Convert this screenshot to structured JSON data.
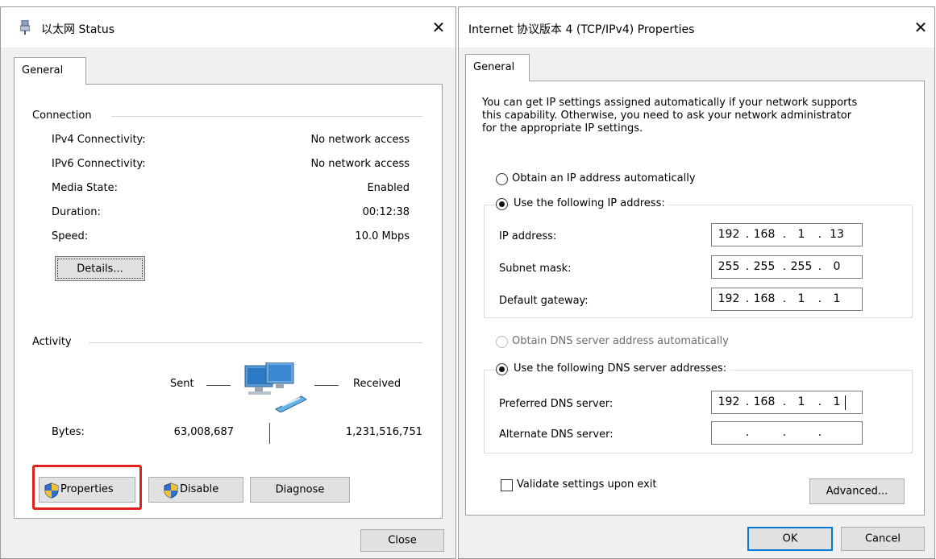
{
  "status_window": {
    "title": "以太网 Status",
    "tab": "General",
    "connection": {
      "heading": "Connection",
      "rows": [
        {
          "label": "IPv4 Connectivity:",
          "value": "No network access"
        },
        {
          "label": "IPv6 Connectivity:",
          "value": "No network access"
        },
        {
          "label": "Media State:",
          "value": "Enabled"
        },
        {
          "label": "Duration:",
          "value": "00:12:38"
        },
        {
          "label": "Speed:",
          "value": "10.0 Mbps"
        }
      ],
      "details_button": "Details..."
    },
    "activity": {
      "heading": "Activity",
      "sent_label": "Sent",
      "received_label": "Received",
      "bytes_label": "Bytes:",
      "bytes_sent": "63,008,687",
      "bytes_received": "1,231,516,751"
    },
    "buttons": {
      "properties": "Properties",
      "disable": "Disable",
      "diagnose": "Diagnose",
      "close": "Close"
    },
    "highlight_color": "#e0211e"
  },
  "ipv4_window": {
    "title": "Internet 协议版本 4 (TCP/IPv4) Properties",
    "tab": "General",
    "intro": [
      "You can get IP settings assigned automatically if your network supports",
      "this capability. Otherwise, you need to ask your network administrator",
      "for the appropriate IP settings."
    ],
    "ip_options": {
      "auto": "Obtain an IP address automatically",
      "manual": "Use the following IP address:",
      "selected": "manual"
    },
    "ip_fields": [
      {
        "label": "IP address:",
        "octets": [
          "192",
          "168",
          "1",
          "13"
        ]
      },
      {
        "label": "Subnet mask:",
        "octets": [
          "255",
          "255",
          "255",
          "0"
        ]
      },
      {
        "label": "Default gateway:",
        "octets": [
          "192",
          "168",
          "1",
          "1"
        ]
      }
    ],
    "dns_options": {
      "auto": "Obtain DNS server address automatically",
      "manual": "Use the following DNS server addresses:",
      "selected": "manual",
      "auto_disabled": true
    },
    "dns_fields": [
      {
        "label": "Preferred DNS server:",
        "octets": [
          "192",
          "168",
          "1",
          "1"
        ]
      },
      {
        "label": "Alternate DNS server:",
        "octets": [
          "",
          "",
          "",
          ""
        ]
      }
    ],
    "validate_label": "Validate settings upon exit",
    "validate_checked": false,
    "advanced_button": "Advanced...",
    "ok_button": "OK",
    "cancel_button": "Cancel"
  },
  "icons": {
    "window_icon": "network-adapter-icon",
    "close": "close-icon",
    "network": "network-computers-icon",
    "shield": "uac-shield-icon"
  }
}
